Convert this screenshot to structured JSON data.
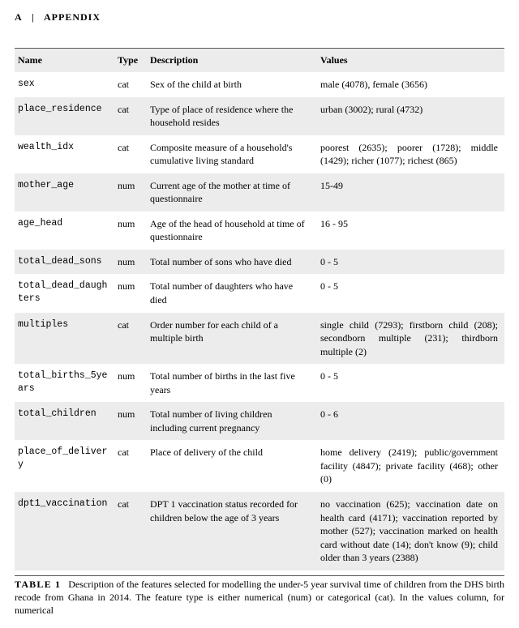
{
  "heading": {
    "letter": "A",
    "separator": "|",
    "text": "APPENDIX"
  },
  "table": {
    "headers": {
      "name": "Name",
      "type": "Type",
      "description": "Description",
      "values": "Values"
    },
    "rows": [
      {
        "name": "sex",
        "type": "cat",
        "description": "Sex of the child at birth",
        "values": "male (4078), female (3656)"
      },
      {
        "name": "place_residence",
        "type": "cat",
        "description": "Type of place of residence where the household resides",
        "values": "urban (3002); rural (4732)"
      },
      {
        "name": "wealth_idx",
        "type": "cat",
        "description": "Composite measure of a household's cumulative living standard",
        "values": "poorest (2635); poorer (1728); middle (1429); richer (1077); richest (865)"
      },
      {
        "name": "mother_age",
        "type": "num",
        "description": "Current age of the mother at time of questionnaire",
        "values": "15-49"
      },
      {
        "name": "age_head",
        "type": "num",
        "description": "Age of the head of household at time of questionnaire",
        "values": "16 - 95"
      },
      {
        "name": "total_dead_sons",
        "type": "num",
        "description": "Total number of sons who have died",
        "values": "0 - 5"
      },
      {
        "name": "total_dead_daughters",
        "type": "num",
        "description": "Total number of daughters who have died",
        "values": "0 - 5"
      },
      {
        "name": "multiples",
        "type": "cat",
        "description": "Order number for each child of a multiple birth",
        "values": "single child (7293); firstborn child (208); secondborn multiple (231); thirdborn multiple (2)"
      },
      {
        "name": "total_births_5years",
        "type": "num",
        "description": "Total number of births in the last five years",
        "values": "0 - 5"
      },
      {
        "name": "total_children",
        "type": "num",
        "description": "Total number of living children including current pregnancy",
        "values": "0 - 6"
      },
      {
        "name": "place_of_delivery",
        "type": "cat",
        "description": "Place of delivery of the child",
        "values": "home delivery (2419); public/government facility (4847); private facility (468); other (0)"
      },
      {
        "name": "dpt1_vaccination",
        "type": "cat",
        "description": "DPT 1 vaccination status recorded for children below the age of 3 years",
        "values": "no vaccination (625); vaccination date on health card (4171); vaccination reported by mother (527); vaccination marked on health card without date (14); don't know (9); child older than 3 years (2388)"
      }
    ]
  },
  "caption": {
    "label": "TABLE 1",
    "text": "Description of the features selected for modelling the under-5 year survival time of children from the DHS birth recode from Ghana in 2014. The feature type is either numerical (num) or categorical (cat). In the values column, for numerical"
  }
}
